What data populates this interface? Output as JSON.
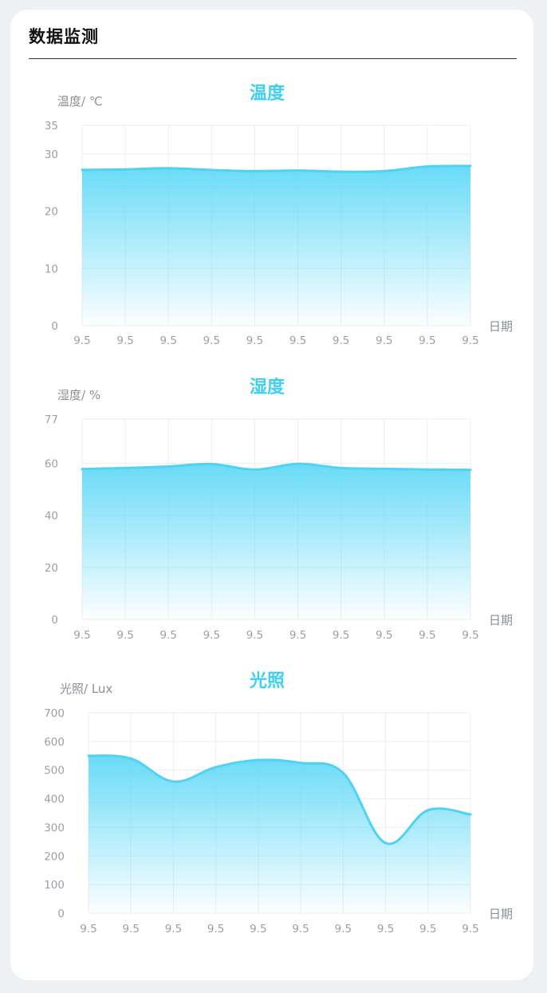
{
  "page": {
    "title": "数据监测"
  },
  "chart_data": [
    {
      "type": "area",
      "title": "温度",
      "ylabel": "温度/ ℃",
      "xlabel": "日期",
      "x": [
        "9.5",
        "9.5",
        "9.5",
        "9.5",
        "9.5",
        "9.5",
        "9.5",
        "9.5",
        "9.5",
        "9.5"
      ],
      "ylim": [
        0,
        35
      ],
      "yticks": [
        0,
        10,
        20,
        30,
        35
      ],
      "series": [
        {
          "values": [
            27.2,
            27.3,
            27.5,
            27.2,
            27.0,
            27.1,
            26.9,
            27.0,
            27.8,
            27.9
          ]
        }
      ],
      "grid": true,
      "color": "#4fd2f4"
    },
    {
      "type": "area",
      "title": "湿度",
      "ylabel": "湿度/ %",
      "xlabel": "日期",
      "x": [
        "9.5",
        "9.5",
        "9.5",
        "9.5",
        "9.5",
        "9.5",
        "9.5",
        "9.5",
        "9.5",
        "9.5"
      ],
      "ylim": [
        0,
        77
      ],
      "yticks": [
        0,
        20,
        40,
        60,
        77
      ],
      "series": [
        {
          "values": [
            57.8,
            58.2,
            58.8,
            59.7,
            57.6,
            59.8,
            58.2,
            57.9,
            57.6,
            57.5
          ]
        }
      ],
      "grid": true,
      "color": "#4fd2f4"
    },
    {
      "type": "area",
      "title": "光照",
      "ylabel": "光照/ Lux",
      "xlabel": "日期",
      "x": [
        "9.5",
        "9.5",
        "9.5",
        "9.5",
        "9.5",
        "9.5",
        "9.5",
        "9.5",
        "9.5",
        "9.5"
      ],
      "ylim": [
        0,
        700
      ],
      "yticks": [
        0,
        100,
        200,
        300,
        400,
        500,
        600,
        700
      ],
      "series": [
        {
          "values": [
            550,
            540,
            460,
            510,
            535,
            525,
            490,
            245,
            360,
            345
          ]
        }
      ],
      "grid": true,
      "color": "#4fd2f4"
    }
  ]
}
